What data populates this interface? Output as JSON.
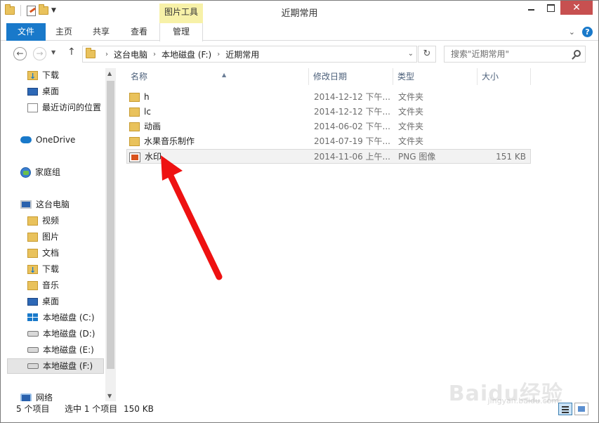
{
  "window": {
    "title": "近期常用",
    "minimize_label": "",
    "maximize_label": "",
    "close_label": "✕"
  },
  "ribbon": {
    "context_group": "图片工具",
    "tabs": {
      "file": "文件",
      "home": "主页",
      "share": "共享",
      "view": "查看",
      "manage": "管理"
    }
  },
  "address": {
    "crumbs": [
      "这台电脑",
      "本地磁盘 (F:)",
      "近期常用"
    ],
    "search_placeholder": "搜索\"近期常用\""
  },
  "nav": {
    "favorites": [
      {
        "label": "下载",
        "icon": "download-folder-icon"
      },
      {
        "label": "桌面",
        "icon": "desktop-icon"
      },
      {
        "label": "最近访问的位置",
        "icon": "recent-places-icon"
      }
    ],
    "onedrive": "OneDrive",
    "homegroup": "家庭组",
    "thispc": "这台电脑",
    "pc_items": [
      {
        "label": "视频",
        "icon": "videos-folder-icon"
      },
      {
        "label": "图片",
        "icon": "pictures-folder-icon"
      },
      {
        "label": "文档",
        "icon": "documents-folder-icon"
      },
      {
        "label": "下载",
        "icon": "download-folder-icon"
      },
      {
        "label": "音乐",
        "icon": "music-folder-icon"
      },
      {
        "label": "桌面",
        "icon": "desktop-icon"
      },
      {
        "label": "本地磁盘 (C:)",
        "icon": "system-drive-icon"
      },
      {
        "label": "本地磁盘 (D:)",
        "icon": "drive-icon"
      },
      {
        "label": "本地磁盘 (E:)",
        "icon": "drive-icon"
      },
      {
        "label": "本地磁盘 (F:)",
        "icon": "drive-icon",
        "selected": true
      }
    ],
    "network": "网络"
  },
  "columns": {
    "name": "名称",
    "date": "修改日期",
    "type": "类型",
    "size": "大小"
  },
  "files": [
    {
      "name": "h",
      "date": "2014-12-12 下午...",
      "type": "文件夹",
      "size": "",
      "icon": "folder-icon"
    },
    {
      "name": "lc",
      "date": "2014-12-12 下午...",
      "type": "文件夹",
      "size": "",
      "icon": "folder-icon"
    },
    {
      "name": "动画",
      "date": "2014-06-02 下午...",
      "type": "文件夹",
      "size": "",
      "icon": "folder-icon"
    },
    {
      "name": "水果音乐制作",
      "date": "2014-07-19 下午...",
      "type": "文件夹",
      "size": "",
      "icon": "folder-icon"
    },
    {
      "name": "水印",
      "date": "2014-11-06 上午...",
      "type": "PNG 图像",
      "size": "151 KB",
      "icon": "png-image-icon"
    }
  ],
  "status": {
    "item_count": "5 个项目",
    "selected": "选中 1 个项目",
    "selected_size": "150 KB"
  },
  "watermark": {
    "main": "Baidu经验",
    "sub": "jingyan.baidu.com"
  },
  "colors": {
    "accent": "#1979ca",
    "context_tab": "#f7f1a8",
    "close_button": "#c75050",
    "annotation_arrow": "#ee1111"
  }
}
